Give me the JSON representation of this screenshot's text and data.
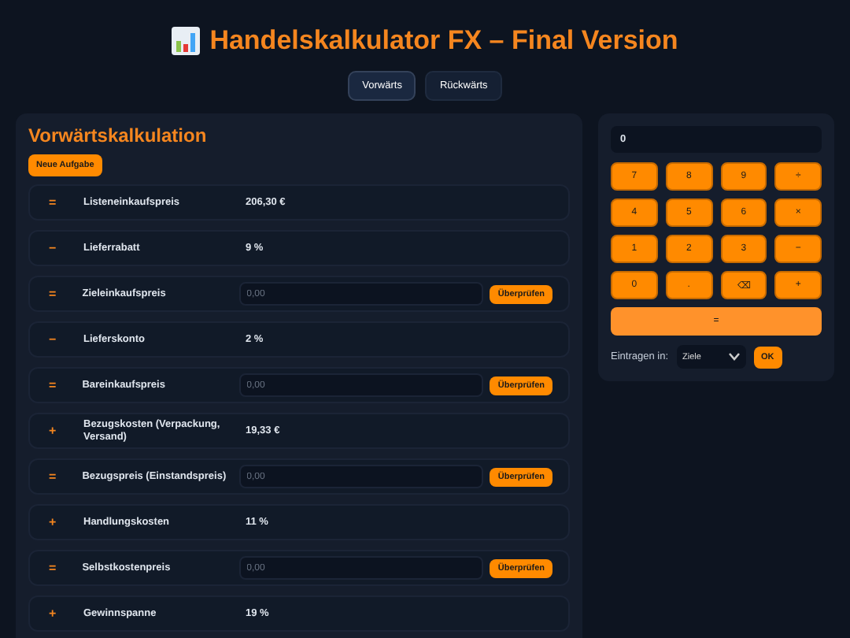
{
  "title": "Handelskalkulator FX – Final Version",
  "modes": [
    {
      "label": "Vorwärts",
      "selected": true
    },
    {
      "label": "Rückwärts",
      "selected": false
    }
  ],
  "panel": {
    "title": "Vorwärtskalkulation",
    "new_task": "Neue Aufgabe",
    "rows": [
      {
        "op": "=",
        "label": "Listeneinkaufspreis",
        "kind": "value",
        "value": "206,30 €"
      },
      {
        "op": "−",
        "label": "Lieferrabatt",
        "kind": "value",
        "value": "9 %"
      },
      {
        "op": "=",
        "label": "Zieleinkaufspreis",
        "kind": "input",
        "placeholder": "0,00",
        "button": "Überprüfen"
      },
      {
        "op": "−",
        "label": "Lieferskonto",
        "kind": "value",
        "value": "2 %"
      },
      {
        "op": "=",
        "label": "Bareinkaufspreis",
        "kind": "input",
        "placeholder": "0,00",
        "button": "Überprüfen"
      },
      {
        "op": "+",
        "label": "Bezugskosten (Verpackung, Versand)",
        "kind": "value",
        "value": "19,33 €"
      },
      {
        "op": "=",
        "label": "Bezugspreis (Einstandspreis)",
        "kind": "input",
        "placeholder": "0,00",
        "button": "Überprüfen"
      },
      {
        "op": "+",
        "label": "Handlungskosten",
        "kind": "value",
        "value": "11 %"
      },
      {
        "op": "=",
        "label": "Selbstkostenpreis",
        "kind": "input",
        "placeholder": "0,00",
        "button": "Überprüfen"
      },
      {
        "op": "+",
        "label": "Gewinnspanne",
        "kind": "value",
        "value": "19 %"
      }
    ]
  },
  "calculator": {
    "display": "0",
    "keys": [
      "7",
      "8",
      "9",
      "÷",
      "4",
      "5",
      "6",
      "×",
      "1",
      "2",
      "3",
      "−",
      "0",
      ".",
      "⌫",
      "+"
    ],
    "equals": "=",
    "enter_label": "Eintragen in:",
    "target": "Ziele",
    "ok": "OK"
  }
}
